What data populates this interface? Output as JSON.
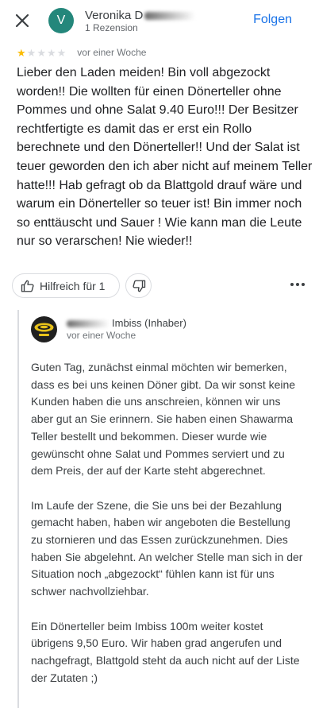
{
  "header": {
    "close_icon": "close-icon",
    "avatar_letter": "V",
    "reviewer_name": "Veronika D",
    "reviewer_meta": "1 Rezension",
    "follow_label": "Folgen"
  },
  "review": {
    "rating": 1,
    "max_rating": 5,
    "colors": {
      "star_filled": "#fbbc04",
      "star_empty": "#dadce0"
    },
    "time": "vor einer Woche",
    "text": "Lieber den Laden meiden! Bin voll abgezockt worden!! Die wollten für einen Dönerteller ohne Pommes und ohne Salat 9.40 Euro!!! Der Besitzer rechtfertigte es damit das er erst ein Rollo berechnete und den Dönerteller!! Und der Salat ist teuer geworden den ich aber nicht auf meinem Teller hatte!!! Hab gefragt ob da Blattgold drauf wäre und warum ein Dönerteller so teuer ist! Bin immer noch so enttäuscht und Sauer ! Wie  kann man die Leute nur so verarschen! Nie wieder!!"
  },
  "actions": {
    "helpful_label": "Hilfreich für 1",
    "helpful_icon": "thumbs-up-icon",
    "dislike_icon": "thumbs-down-icon",
    "more_icon": "more-horizontal-icon"
  },
  "owner_reply": {
    "name": "Imbiss (Inhaber)",
    "time": "vor einer Woche",
    "paragraphs": [
      "Guten Tag, zunächst einmal möchten wir bemerken, dass es bei uns keinen Döner gibt. Da wir sonst keine Kunden haben die uns anschreien, können wir uns aber gut an Sie erinnern. Sie haben einen Shawarma Teller bestellt und bekommen. Dieser wurde wie gewünscht ohne Salat und Pommes serviert und zu dem Preis, der auf der Karte steht abgerechnet.",
      "Im Laufe der Szene, die Sie uns bei der Bezahlung gemacht haben, haben wir angeboten die Bestellung zu stornieren und das Essen zurückzunehmen. Dies haben Sie abgelehnt. An welcher Stelle man sich in der Situation noch „abgezockt“ fühlen kann ist für uns schwer nachvollziehbar.",
      "Ein Dönerteller beim Imbiss 100m weiter kostet übrigens 9,50 Euro. Wir haben grad angerufen und nachgefragt, Blattgold steht da auch nicht auf der Liste der Zutaten ;)"
    ]
  }
}
